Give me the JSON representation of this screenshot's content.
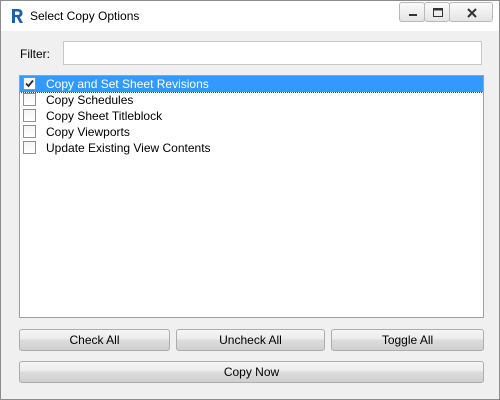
{
  "window": {
    "title": "Select Copy Options",
    "icon": "revit-r-icon",
    "controls": [
      "minimize-icon",
      "maximize-icon",
      "close-icon"
    ]
  },
  "filter": {
    "label": "Filter:",
    "value": "",
    "placeholder": ""
  },
  "options": [
    {
      "label": "Copy and Set Sheet Revisions",
      "checked": true,
      "selected": true
    },
    {
      "label": "Copy Schedules",
      "checked": false,
      "selected": false
    },
    {
      "label": "Copy Sheet Titleblock",
      "checked": false,
      "selected": false
    },
    {
      "label": "Copy Viewports",
      "checked": false,
      "selected": false
    },
    {
      "label": "Update Existing View Contents",
      "checked": false,
      "selected": false
    }
  ],
  "buttons": {
    "check_all": "Check All",
    "uncheck_all": "Uncheck All",
    "toggle_all": "Toggle All",
    "copy_now": "Copy Now"
  },
  "colors": {
    "selection": "#3399ff",
    "icon_blue": "#1f5fa8"
  }
}
